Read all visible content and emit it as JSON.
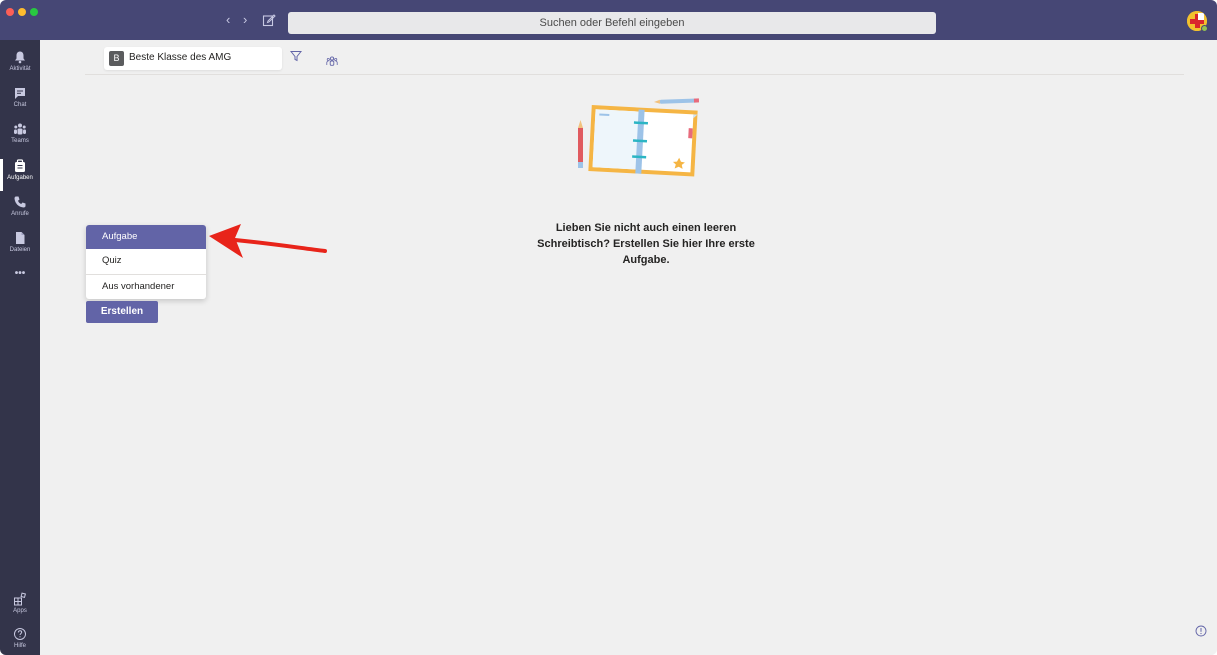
{
  "titlebar": {
    "back_icon": "chevron-left-icon",
    "forward_icon": "chevron-right-icon",
    "compose_icon": "compose-icon",
    "search_placeholder": "Suchen oder Befehl eingeben",
    "colors": {
      "bar": "#464775",
      "search_bg": "#e8e8ea"
    }
  },
  "rail": {
    "items": [
      {
        "label": "Aktivität",
        "icon": "bell-icon"
      },
      {
        "label": "Chat",
        "icon": "chat-icon"
      },
      {
        "label": "Teams",
        "icon": "teams-icon"
      },
      {
        "label": "Aufgaben",
        "icon": "assignments-icon",
        "active": true
      },
      {
        "label": "Anrufe",
        "icon": "phone-icon"
      },
      {
        "label": "Dateien",
        "icon": "file-icon"
      },
      {
        "label": "•••",
        "icon": "more-icon"
      }
    ],
    "bottom": [
      {
        "label": "Apps",
        "icon": "apps-icon"
      },
      {
        "label": "Hilfe",
        "icon": "help-icon"
      }
    ]
  },
  "header": {
    "class_initial": "B",
    "class_name": "Beste Klasse des AMG",
    "class_icon": "class-members-icon",
    "filter_icon": "filter-icon"
  },
  "main": {
    "empty_message": "Lieben Sie nicht auch einen leeren Schreibtisch? Erstellen Sie hier Ihre erste Aufgabe.",
    "illustration": "empty-desk-illustration"
  },
  "create_menu": {
    "items": [
      "Aufgabe",
      "Quiz",
      "Aus vorhandener"
    ],
    "selected": "Aufgabe",
    "create_label": "Erstellen",
    "accent": "#6264a7"
  },
  "annotation": {
    "arrow_color": "#e8241a"
  }
}
